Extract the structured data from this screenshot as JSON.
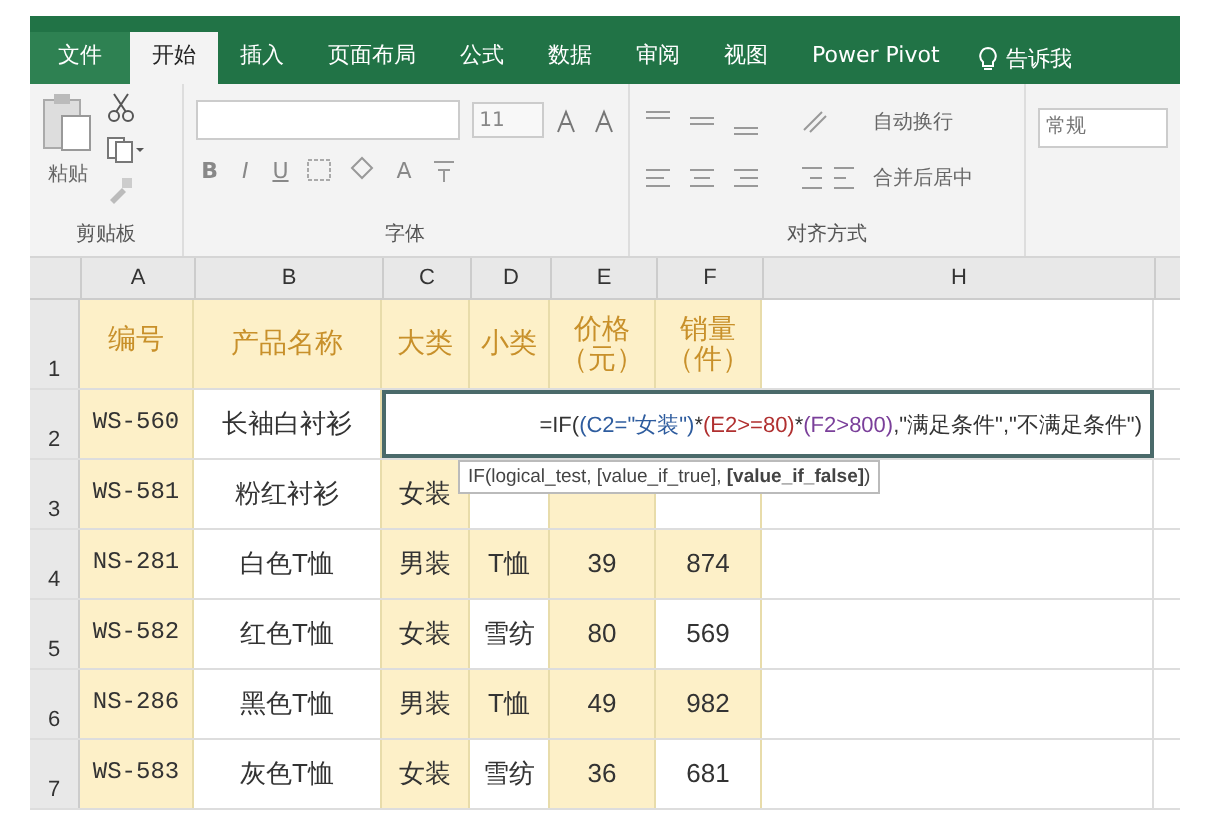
{
  "tabs": [
    {
      "label": "文件",
      "kind": "file",
      "selected": false
    },
    {
      "label": "开始",
      "kind": "tab",
      "selected": true
    },
    {
      "label": "插入",
      "kind": "tab",
      "selected": false
    },
    {
      "label": "页面布局",
      "kind": "tab",
      "selected": false
    },
    {
      "label": "公式",
      "kind": "tab",
      "selected": false
    },
    {
      "label": "数据",
      "kind": "tab",
      "selected": false
    },
    {
      "label": "审阅",
      "kind": "tab",
      "selected": false
    },
    {
      "label": "视图",
      "kind": "tab",
      "selected": false
    },
    {
      "label": "Power Pivot",
      "kind": "tab",
      "selected": false
    },
    {
      "label": "告诉我",
      "kind": "tell",
      "selected": false
    }
  ],
  "clipboard": {
    "paste": "粘贴",
    "label": "剪贴板"
  },
  "font": {
    "size": "11",
    "bold": "B",
    "italic": "I",
    "underline": "U",
    "color_letter": "A",
    "label": "字体"
  },
  "alignment": {
    "wrap": "自动换行",
    "merge": "合并后居中",
    "label": "对齐方式"
  },
  "number": {
    "format": "常规"
  },
  "columns": [
    "A",
    "B",
    "C",
    "D",
    "E",
    "F",
    "H"
  ],
  "rows": [
    {
      "number": "1",
      "kind": "header",
      "cells": [
        "编号",
        "产品名称",
        "大类",
        "小类",
        "价格（元）",
        "销量（件）"
      ]
    },
    {
      "number": "2",
      "kind": "edit",
      "cells": [
        "WS-560",
        "长袖白衬衫"
      ]
    },
    {
      "number": "3",
      "kind": "data",
      "cells": [
        "WS-581",
        "粉红衬衫",
        "女装"
      ]
    },
    {
      "number": "4",
      "kind": "data",
      "cells": [
        "NS-281",
        "白色T恤",
        "男装",
        "T恤",
        "39",
        "874"
      ]
    },
    {
      "number": "5",
      "kind": "data",
      "cells": [
        "WS-582",
        "红色T恤",
        "女装",
        "雪纺",
        "80",
        "569"
      ]
    },
    {
      "number": "6",
      "kind": "data",
      "cells": [
        "NS-286",
        "黑色T恤",
        "男装",
        "T恤",
        "49",
        "982"
      ]
    },
    {
      "number": "7",
      "kind": "data",
      "cells": [
        "WS-583",
        "灰色T恤",
        "女装",
        "雪纺",
        "36",
        "681"
      ]
    }
  ],
  "editor": {
    "parts": [
      {
        "text": "=IF(",
        "color": "#333333"
      },
      {
        "text": "(C2=\"女装\")",
        "color": "#2e5c9e"
      },
      {
        "text": "*",
        "color": "#333333"
      },
      {
        "text": "(E2>=80)",
        "color": "#b03030"
      },
      {
        "text": "*",
        "color": "#333333"
      },
      {
        "text": "(F2>800)",
        "color": "#7a3f9a"
      },
      {
        "text": ",\"满足条件\",\"不满足条件\")",
        "color": "#333333"
      }
    ],
    "tooltip": "IF(logical_test, [value_if_true], **[value_if_false]**)"
  }
}
